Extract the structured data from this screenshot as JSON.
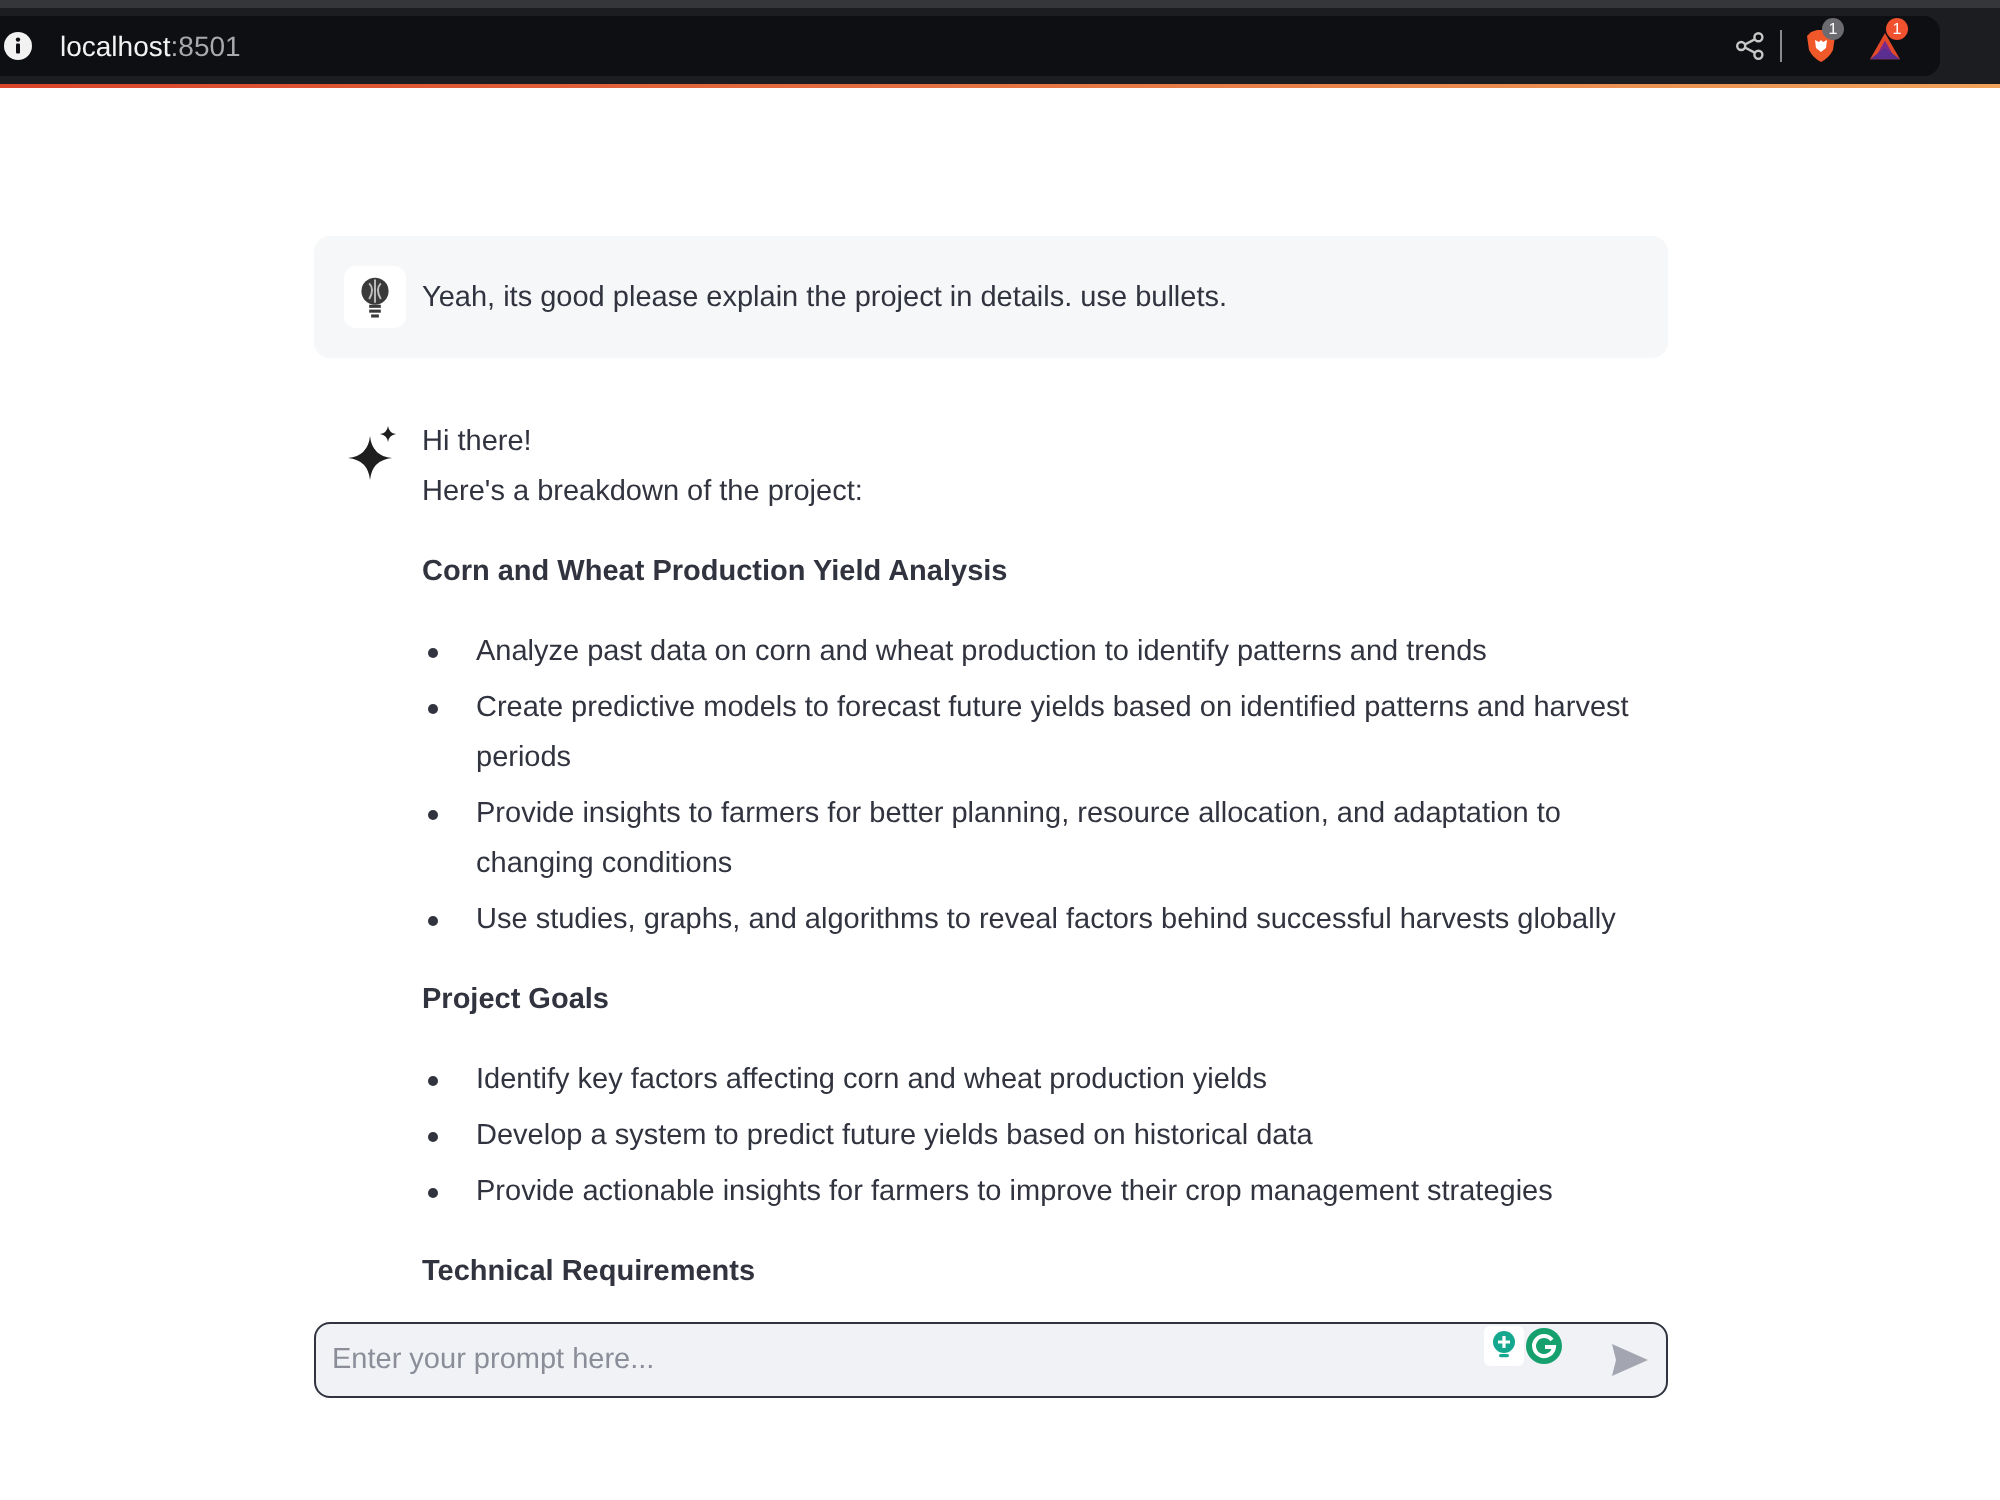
{
  "browser": {
    "address": {
      "host": "localhost",
      "port": ":8501"
    },
    "extensions": [
      {
        "kind": "shield",
        "badge": "1"
      },
      {
        "kind": "triangle",
        "badge": "1"
      }
    ]
  },
  "messages": [
    {
      "kind": "prompt",
      "text": "Yeah, its good please explain the project in details. use bullets."
    },
    {
      "kind": "reply",
      "blocks": [
        {
          "kind": "paragraph",
          "lines": [
            "Hi there!",
            "Here's a breakdown of the project:"
          ]
        },
        {
          "kind": "heading",
          "text": "Corn and Wheat Production Yield Analysis"
        },
        {
          "kind": "list",
          "items": [
            "Analyze past data on corn and wheat production to identify patterns and trends",
            "Create predictive models to forecast future yields based on identified patterns and harvest periods",
            "Provide insights to farmers for better planning, resource allocation, and adaptation to changing conditions",
            "Use studies, graphs, and algorithms to reveal factors behind successful harvests globally"
          ]
        },
        {
          "kind": "heading",
          "text": "Project Goals"
        },
        {
          "kind": "list",
          "items": [
            "Identify key factors affecting corn and wheat production yields",
            "Develop a system to predict future yields based on historical data",
            "Provide actionable insights for farmers to improve their crop management strategies"
          ]
        },
        {
          "kind": "heading",
          "text": "Technical Requirements"
        }
      ]
    }
  ],
  "input": {
    "placeholder": "Enter your prompt here..."
  }
}
